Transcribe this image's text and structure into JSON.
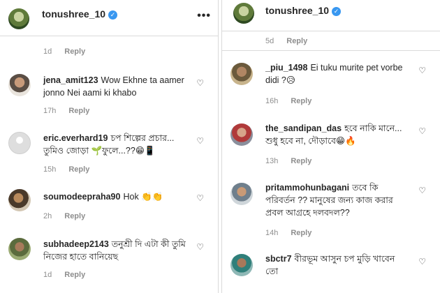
{
  "left": {
    "header": {
      "username": "tonushree_10",
      "more": "•••"
    },
    "top_meta": {
      "time": "1d",
      "reply": "Reply"
    },
    "comments": [
      {
        "user": "jena_amit123",
        "text": "Wow Ekhne ta aamer jonno Nei aami ki khabo",
        "time": "17h",
        "reply": "Reply"
      },
      {
        "user": "eric.everhard19",
        "text": "চপ শিল্পের প্রচার... তুমিও জোড়া 🌱ফুলে...??😁📱",
        "time": "15h",
        "reply": "Reply"
      },
      {
        "user": "soumodeepraha90",
        "text": "Hok 👏👏",
        "time": "2h",
        "reply": "Reply"
      },
      {
        "user": "subhadeep2143",
        "text": "তনুশ্রী দি এটা কী তুমি নিজের হাতে বানিয়েছ",
        "time": "1d",
        "reply": "Reply"
      }
    ]
  },
  "right": {
    "header": {
      "username": "tonushree_10"
    },
    "top_meta": {
      "time": "5d",
      "reply": "Reply"
    },
    "comments": [
      {
        "user": "_piu_1498",
        "text": "Ei tuku murite pet vorbe didi ?😥",
        "time": "16h",
        "reply": "Reply"
      },
      {
        "user": "the_sandipan_das",
        "text": "হবে নাকি মানে... শুধু হবে না, দৌড়াবে😁🔥",
        "time": "13h",
        "reply": "Reply"
      },
      {
        "user": "pritammohunbagani",
        "text": "তবে কি পরিবর্তন ?? মানুষের জন্য কাজ করার প্রবল আগ্রহে দলবদল??",
        "time": "14h",
        "reply": "Reply"
      },
      {
        "user": "sbctr7",
        "text": "বীরভূম আসুন চপ মুড়ি খাবেন তো",
        "time": "",
        "reply": ""
      }
    ]
  },
  "icons": {
    "heart": "♡",
    "verified": "✓"
  },
  "colors": {
    "text": "#262626",
    "muted": "#8e8e8e",
    "verified": "#3897f0",
    "border": "#dbdbdb"
  }
}
